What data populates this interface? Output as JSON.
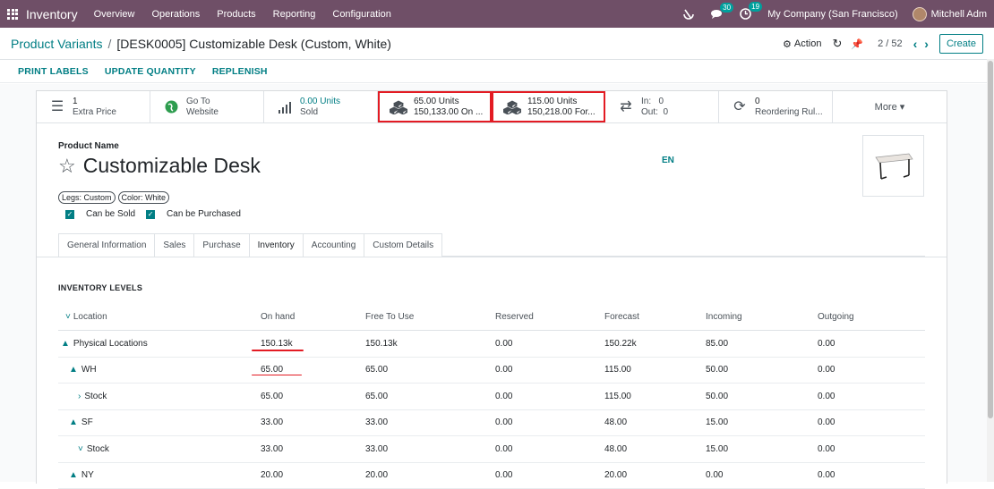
{
  "topbar": {
    "app": "Inventory",
    "menus": [
      "Overview",
      "Operations",
      "Products",
      "Reporting",
      "Configuration"
    ],
    "activity_count": "30",
    "clock_count": "19",
    "company": "My Company (San Francisco)",
    "user": "Mitchell Adm"
  },
  "control": {
    "breadcrumb_parent": "Product Variants",
    "breadcrumb_sep": "/",
    "breadcrumb_current": "[DESK0005] Customizable Desk (Custom, White)",
    "action": "Action",
    "pager": "2 / 52",
    "create": "Create"
  },
  "statusbar": {
    "buttons": [
      "PRINT LABELS",
      "UPDATE QUANTITY",
      "REPLENISH"
    ]
  },
  "smartbuttons": [
    {
      "icon": "list-icon",
      "val": "1",
      "lbl": "Extra Price"
    },
    {
      "icon": "globe-icon",
      "val": "Go To",
      "lbl": "Website"
    },
    {
      "icon": "bar-chart-icon",
      "val": "0.00 Units",
      "lbl": "Sold"
    },
    {
      "icon": "cubes-icon",
      "val": "65.00 Units",
      "lbl": "150,133.00 On ..."
    },
    {
      "icon": "cubes-icon",
      "val": "115.00 Units",
      "lbl": "150,218.00 For..."
    },
    {
      "icon": "exchange-icon",
      "val": "In:   0",
      "lbl": "Out:  0"
    },
    {
      "icon": "refresh-icon",
      "val": "0",
      "lbl": "Reordering Rul..."
    },
    {
      "icon": "",
      "val": "More ▾",
      "lbl": ""
    }
  ],
  "product": {
    "name_label": "Product Name",
    "name": "Customizable Desk",
    "lang": "EN",
    "tags": [
      "Legs: Custom",
      "Color: White"
    ],
    "can_sold": "Can be Sold",
    "can_purchased": "Can be Purchased"
  },
  "tabs": [
    "General Information",
    "Sales",
    "Purchase",
    "Inventory",
    "Accounting",
    "Custom Details"
  ],
  "inventory": {
    "title": "INVENTORY LEVELS",
    "headers": [
      "Location",
      "On hand",
      "Free To Use",
      "Reserved",
      "Forecast",
      "Incoming",
      "Outgoing"
    ],
    "rows": [
      {
        "exp": "▲",
        "name": "Physical Locations",
        "indent": 0,
        "vals": [
          "150.13k",
          "150.13k",
          "0.00",
          "150.22k",
          "85.00",
          "0.00"
        ]
      },
      {
        "exp": "▲",
        "name": "WH",
        "indent": 1,
        "vals": [
          "65.00",
          "65.00",
          "0.00",
          "115.00",
          "50.00",
          "0.00"
        ]
      },
      {
        "exp": "›",
        "name": "Stock",
        "indent": 2,
        "vals": [
          "65.00",
          "65.00",
          "0.00",
          "115.00",
          "50.00",
          "0.00"
        ]
      },
      {
        "exp": "▲",
        "name": "SF",
        "indent": 1,
        "vals": [
          "33.00",
          "33.00",
          "0.00",
          "48.00",
          "15.00",
          "0.00"
        ]
      },
      {
        "exp": "˅",
        "name": "Stock",
        "indent": 2,
        "vals": [
          "33.00",
          "33.00",
          "0.00",
          "48.00",
          "15.00",
          "0.00"
        ]
      },
      {
        "exp": "▲",
        "name": "NY",
        "indent": 1,
        "vals": [
          "20.00",
          "20.00",
          "0.00",
          "20.00",
          "0.00",
          "0.00"
        ]
      }
    ]
  }
}
